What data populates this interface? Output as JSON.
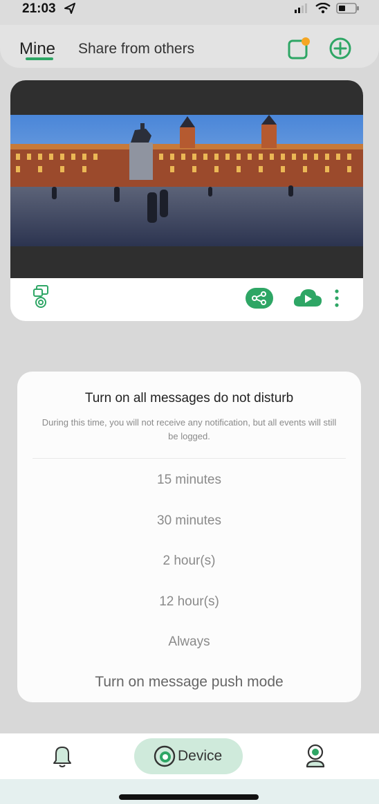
{
  "status_bar": {
    "time": "21:03"
  },
  "header": {
    "tab_mine": "Mine",
    "tab_shared": "Share from others"
  },
  "dialog": {
    "title": "Turn on all messages do not disturb",
    "description": "During this time, you will not receive any notification, but all events will still be logged.",
    "options": [
      "15 minutes",
      "30 minutes",
      "2 hour(s)",
      "12 hour(s)",
      "Always"
    ],
    "push_mode": "Turn on message push mode"
  },
  "bottom_nav": {
    "device_label": "Device"
  },
  "colors": {
    "accent": "#2ea665",
    "accent_light": "#cfeadb",
    "badge": "#f5a623"
  },
  "icons": {
    "header": [
      "message-notification-icon",
      "add-device-icon"
    ],
    "card": [
      "ptz-camera-icon",
      "share-icon",
      "cloud-play-icon",
      "more-vertical-icon"
    ],
    "nav": [
      "bell-icon",
      "device-icon",
      "profile-icon"
    ]
  }
}
